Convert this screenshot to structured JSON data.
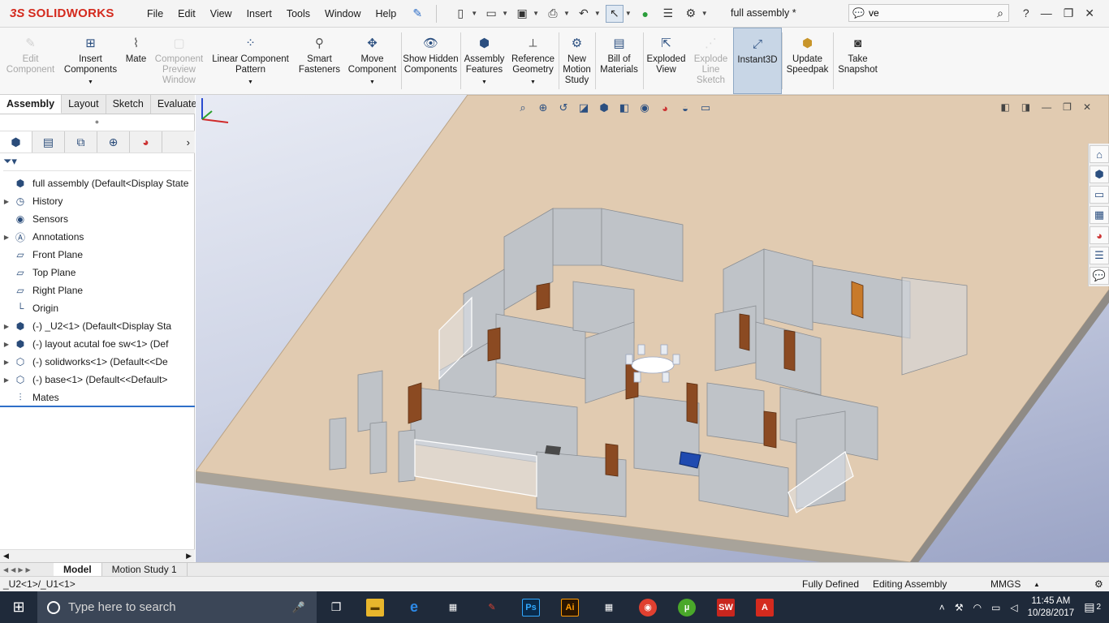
{
  "app": {
    "brand_ds": "3S",
    "brand_name": "SOLIDWORKS",
    "doc_title": "full assembly *",
    "search_value": "ve",
    "help_label": "?"
  },
  "menu": [
    "File",
    "Edit",
    "View",
    "Insert",
    "Tools",
    "Window",
    "Help"
  ],
  "commands": [
    {
      "label": "Edit Component",
      "icon": "edit-component-icon",
      "enabled": false
    },
    {
      "label": "Insert Components",
      "icon": "insert-components-icon",
      "enabled": true
    },
    {
      "label": "Mate",
      "icon": "mate-icon",
      "enabled": true
    },
    {
      "label": "Component Preview Window",
      "icon": "component-preview-icon",
      "enabled": false
    },
    {
      "label": "Linear Component Pattern",
      "icon": "linear-pattern-icon",
      "enabled": true
    },
    {
      "label": "Smart Fasteners",
      "icon": "smart-fasteners-icon",
      "enabled": true
    },
    {
      "label": "Move Component",
      "icon": "move-component-icon",
      "enabled": true
    },
    {
      "label": "Show Hidden Components",
      "icon": "show-hidden-icon",
      "enabled": true
    },
    {
      "label": "Assembly Features",
      "icon": "assembly-features-icon",
      "enabled": true
    },
    {
      "label": "Reference Geometry",
      "icon": "reference-geometry-icon",
      "enabled": true
    },
    {
      "label": "New Motion Study",
      "icon": "motion-study-icon",
      "enabled": true
    },
    {
      "label": "Bill of Materials",
      "icon": "bom-icon",
      "enabled": true
    },
    {
      "label": "Exploded View",
      "icon": "exploded-view-icon",
      "enabled": true
    },
    {
      "label": "Explode Line Sketch",
      "icon": "explode-line-icon",
      "enabled": false
    },
    {
      "label": "Instant3D",
      "icon": "instant3d-icon",
      "enabled": true,
      "active": true
    },
    {
      "label": "Update Speedpak",
      "icon": "speedpak-icon",
      "enabled": true
    },
    {
      "label": "Take Snapshot",
      "icon": "snapshot-icon",
      "enabled": true
    }
  ],
  "cm_tabs": [
    "Assembly",
    "Layout",
    "Sketch",
    "Evaluate"
  ],
  "tree": [
    {
      "label": "full assembly  (Default<Display State",
      "icon": "assembly-icon",
      "expand": ""
    },
    {
      "label": "History",
      "icon": "history-icon",
      "expand": "›"
    },
    {
      "label": "Sensors",
      "icon": "sensors-icon",
      "expand": ""
    },
    {
      "label": "Annotations",
      "icon": "annotations-icon",
      "expand": "›"
    },
    {
      "label": "Front Plane",
      "icon": "plane-icon",
      "expand": ""
    },
    {
      "label": "Top Plane",
      "icon": "plane-icon",
      "expand": ""
    },
    {
      "label": "Right Plane",
      "icon": "plane-icon",
      "expand": ""
    },
    {
      "label": "Origin",
      "icon": "origin-icon",
      "expand": ""
    },
    {
      "label": "(-) _U2<1> (Default<Display Sta",
      "icon": "subassembly-icon",
      "expand": "›"
    },
    {
      "label": "(-) layout acutal foe sw<1> (Def",
      "icon": "subassembly-icon",
      "expand": "›"
    },
    {
      "label": "(-) solidworks<1> (Default<<De",
      "icon": "part-icon",
      "expand": "›"
    },
    {
      "label": "(-) base<1> (Default<<Default>",
      "icon": "part-icon",
      "expand": "›"
    },
    {
      "label": "Mates",
      "icon": "mates-icon",
      "expand": ""
    }
  ],
  "model_tabs": [
    "Model",
    "Motion Study 1"
  ],
  "status": {
    "selection": "_U2<1>/_U1<1>",
    "defined": "Fully Defined",
    "mode": "Editing Assembly",
    "units": "MMGS"
  },
  "taskbar": {
    "search_placeholder": "Type here to search",
    "time": "11:45 AM",
    "date": "10/28/2017",
    "notif_count": "2",
    "apps": [
      "task-view-icon",
      "file-explorer-icon",
      "edge-icon",
      "store-icon",
      "paint-icon",
      "photoshop-icon",
      "illustrator-icon",
      "calculator-icon",
      "chrome-icon",
      "utorrent-icon",
      "solidworks-icon",
      "autocad-icon"
    ]
  },
  "colors": {
    "brand": "#d42a1e",
    "selection_line": "#2f6fc8",
    "floor": "#e1cbb1",
    "wall": "#bfc3c8",
    "door": "#8b4a22"
  }
}
